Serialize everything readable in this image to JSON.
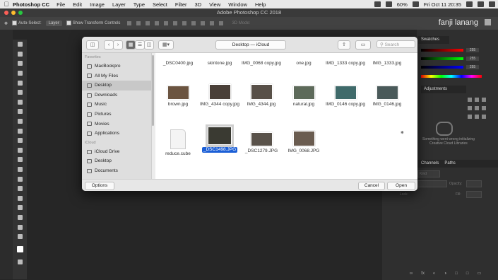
{
  "menubar": {
    "app_name": "Photoshop CC",
    "menus": [
      "File",
      "Edit",
      "Image",
      "Layer",
      "Type",
      "Select",
      "Filter",
      "3D",
      "View",
      "Window",
      "Help"
    ],
    "battery": "60%",
    "datetime": "Fri Oct 11  20:35"
  },
  "window": {
    "title": "Adobe Photoshop CC 2018",
    "user": "fanji lanang"
  },
  "options_bar": {
    "auto_select_label": "Auto-Select:",
    "auto_select_value": "Layer",
    "transform_label": "Show Transform Controls",
    "mode_label": "3D Mode:"
  },
  "panels": {
    "swatches": "Swatches",
    "swatch_values": [
      "255",
      "255",
      "255"
    ],
    "adjustments": "Adjustments",
    "cc_error": "Something went wrong initializing Creative Cloud Libraries",
    "channels": "Channels",
    "paths": "Paths",
    "kind_label": "Kind",
    "opacity_label": "Opacity:",
    "lock_label": "Lock:",
    "fill_label": "Fill:"
  },
  "dialog": {
    "location": "Desktop — iCloud",
    "search_placeholder": "Search",
    "sidebar": {
      "favorites_header": "Favorites",
      "favorites": [
        "MacBookpro",
        "All My Files",
        "Desktop",
        "Downloads",
        "Music",
        "Pictures",
        "Movies",
        "Applications"
      ],
      "icloud_header": "iCloud",
      "icloud": [
        "iCloud Drive",
        "Desktop",
        "Documents"
      ]
    },
    "files_row1": [
      "_DSC0400.jpg",
      "skintone.jpg",
      "IMG_0068 copy.jpg",
      "one.jpg",
      "IMG_1333 copy.jpg",
      "IMG_1333.jpg"
    ],
    "files_row2": [
      "brown.jpg",
      "IMG_4344 copy.jpg",
      "IMG_4344.jpg",
      "natural.jpg",
      "IMG_0146 copy.jpg",
      "IMG_0146.jpg"
    ],
    "files_row3": [
      "reduce.cube",
      "_DSC1498.JPG",
      "_DSC1279.JPG",
      "IMG_0068.JPG"
    ],
    "options_button": "Options",
    "cancel_button": "Cancel",
    "open_button": "Open"
  },
  "colors": {
    "accent": "#1c5fd6",
    "ps_bg": "#262626"
  }
}
